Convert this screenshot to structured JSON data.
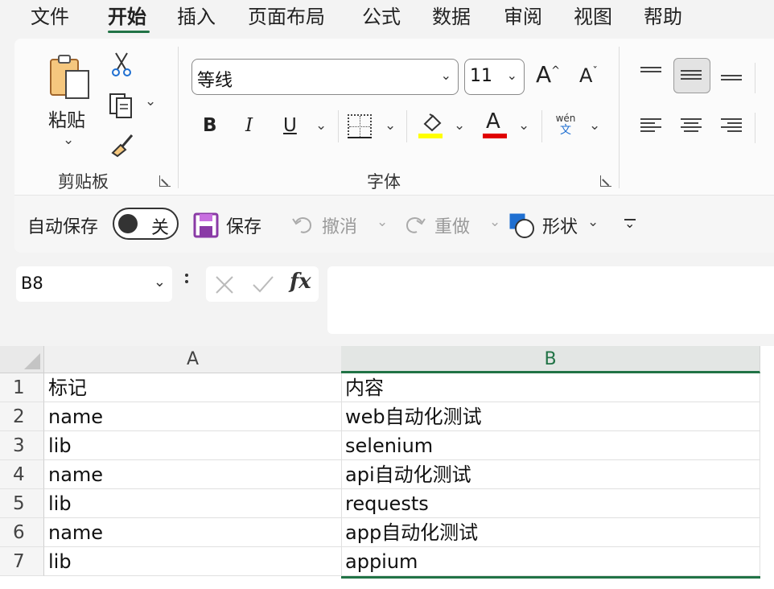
{
  "menu": {
    "tabs": [
      "文件",
      "开始",
      "插入",
      "页面布局",
      "公式",
      "数据",
      "审阅",
      "视图",
      "帮助"
    ],
    "active_index": 1
  },
  "ribbon": {
    "clipboard": {
      "paste_label": "粘贴",
      "group_label": "剪贴板"
    },
    "font": {
      "font_name": "等线",
      "font_size": "11",
      "bold_label": "B",
      "italic_label": "I",
      "underline_label": "U",
      "font_color_label": "A",
      "phonetic_top": "wén",
      "phonetic_bottom": "文",
      "group_label": "字体",
      "highlight_color": "#ffff00",
      "font_color": "#e00000"
    }
  },
  "quick_access": {
    "autosave_label": "自动保存",
    "autosave_state": "关",
    "save_label": "保存",
    "undo_label": "撤消",
    "redo_label": "重做",
    "shapes_label": "形状"
  },
  "formula_bar": {
    "name_box": "B8",
    "fx_label": "fx",
    "formula": ""
  },
  "sheet": {
    "columns": [
      "A",
      "B"
    ],
    "rows": [
      {
        "n": "1",
        "a": "标记",
        "b": "内容"
      },
      {
        "n": "2",
        "a": "name",
        "b": "web自动化测试"
      },
      {
        "n": "3",
        "a": "lib",
        "b": "selenium"
      },
      {
        "n": "4",
        "a": "name",
        "b": "api自动化测试"
      },
      {
        "n": "5",
        "a": "lib",
        "b": "requests"
      },
      {
        "n": "6",
        "a": "name",
        "b": "app自动化测试"
      },
      {
        "n": "7",
        "a": "lib",
        "b": "appium"
      }
    ],
    "accent_color": "#217346"
  }
}
